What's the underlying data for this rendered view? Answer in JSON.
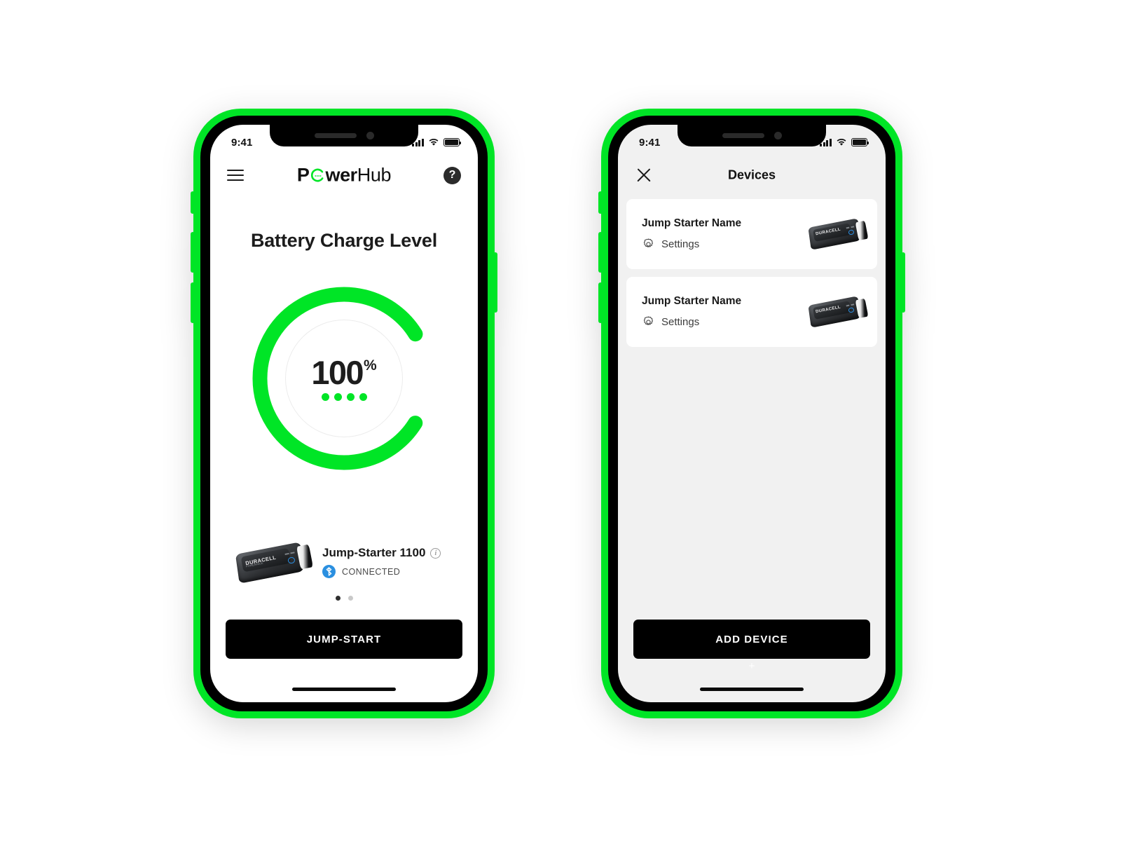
{
  "meta": {
    "accent_green": "#00e526",
    "black": "#000000",
    "card_bg": "#ffffff",
    "screen_gray": "#f1f1f1",
    "bluetooth_blue": "#2a8fe0"
  },
  "status_bar": {
    "time": "9:41",
    "signal_icon": "signal-bars-icon",
    "wifi_icon": "wifi-icon",
    "battery_icon": "battery-full-icon"
  },
  "home_screen": {
    "app_bar": {
      "menu_icon": "hamburger-menu-icon",
      "brand_part1": "P",
      "brand_gauge_icon": "gauge-o-icon",
      "brand_part2": "wer",
      "brand_part3": "Hub",
      "help_label": "?",
      "help_icon": "help-question-icon"
    },
    "page_title": "Battery Charge Level",
    "gauge": {
      "value": "100",
      "unit": "%",
      "percent_number": 100,
      "arc_color": "#00e526",
      "indicator_dots": 4
    },
    "device": {
      "name": "Jump-Starter 1100",
      "info_icon": "info-circle-icon",
      "product_image": "duracell-jump-starter-image",
      "brand_on_product": "DURACELL",
      "brand_subline": "POWERPACK",
      "bluetooth_icon": "bluetooth-icon",
      "connection_status": "CONNECTED"
    },
    "pagination": {
      "total": 2,
      "active_index": 0
    },
    "primary_button": "JUMP-START"
  },
  "devices_screen": {
    "app_bar": {
      "close_icon": "close-x-icon",
      "title": "Devices"
    },
    "devices": [
      {
        "name": "Jump Starter Name",
        "settings_label": "Settings",
        "settings_icon": "gear-icon",
        "product_image": "duracell-jump-starter-image",
        "brand_on_product": "DURACELL",
        "brand_subline": "POWERPACK"
      },
      {
        "name": "Jump Starter Name",
        "settings_label": "Settings",
        "settings_icon": "gear-icon",
        "product_image": "duracell-jump-starter-image",
        "brand_on_product": "DURACELL",
        "brand_subline": "POWERPACK"
      }
    ],
    "primary_button": "ADD DEVICE",
    "add_glyph": "+"
  }
}
